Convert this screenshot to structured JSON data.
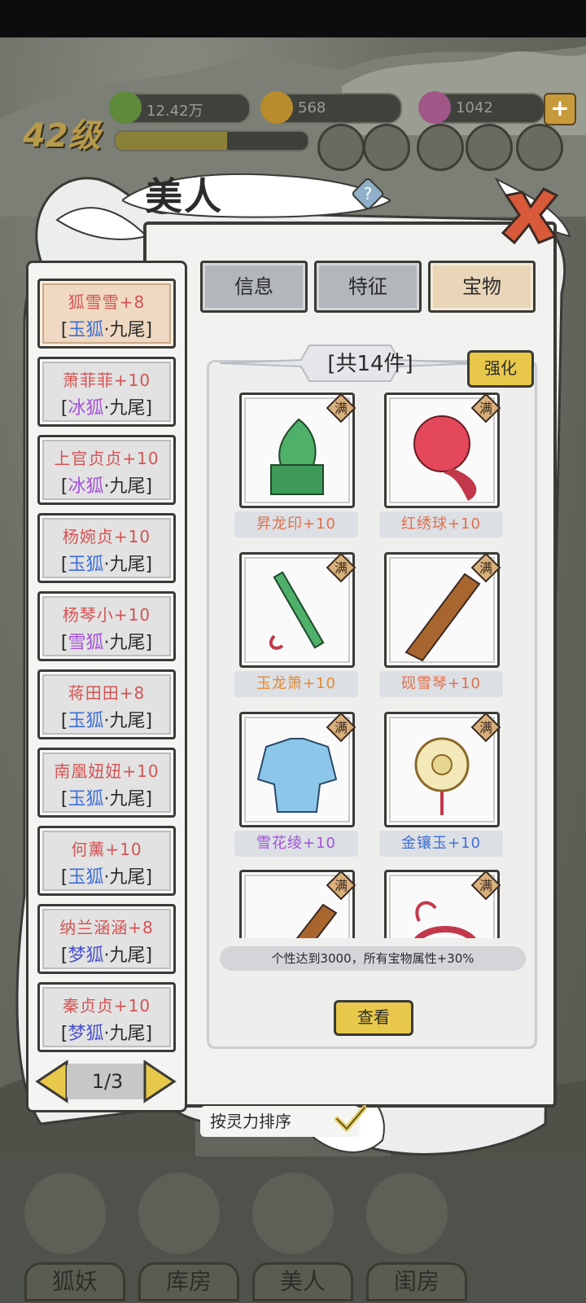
{
  "resources": {
    "spirit": "12.42万",
    "gold": "568",
    "gems": "1042"
  },
  "level": "42级",
  "exp_progress": 0.58,
  "title": "美人",
  "tabs": [
    {
      "label": "信息",
      "active": false
    },
    {
      "label": "特征",
      "active": false
    },
    {
      "label": "宝物",
      "active": true
    }
  ],
  "beauties": [
    {
      "name": "狐雪雪+8",
      "br_l": "[",
      "fox": "玉狐",
      "fox_color": "#3e6fd6",
      "rest": "·九尾",
      "br_r": "]",
      "selected": true
    },
    {
      "name": "萧菲菲+10",
      "br_l": "[",
      "fox": "冰狐",
      "fox_color": "#a352d8",
      "rest": "·九尾",
      "br_r": "]",
      "selected": false
    },
    {
      "name": "上官贞贞+10",
      "br_l": "[",
      "fox": "冰狐",
      "fox_color": "#a352d8",
      "rest": "·九尾",
      "br_r": "]",
      "selected": false
    },
    {
      "name": "杨婉贞+10",
      "br_l": "[",
      "fox": "玉狐",
      "fox_color": "#3e6fd6",
      "rest": "·九尾",
      "br_r": "]",
      "selected": false
    },
    {
      "name": "杨琴小+10",
      "br_l": "[",
      "fox": "雪狐",
      "fox_color": "#a352d8",
      "rest": "·九尾",
      "br_r": "]",
      "selected": false
    },
    {
      "name": "蒋田田+8",
      "br_l": "[",
      "fox": "玉狐",
      "fox_color": "#3e6fd6",
      "rest": "·九尾",
      "br_r": "]",
      "selected": false
    },
    {
      "name": "南凰妞妞+10",
      "br_l": "[",
      "fox": "玉狐",
      "fox_color": "#3e6fd6",
      "rest": "·九尾",
      "br_r": "]",
      "selected": false
    },
    {
      "name": "何薰+10",
      "br_l": "[",
      "fox": "玉狐",
      "fox_color": "#3e6fd6",
      "rest": "·九尾",
      "br_r": "]",
      "selected": false
    },
    {
      "name": "纳兰涵涵+8",
      "br_l": "[",
      "fox": "梦狐",
      "fox_color": "#4a52cc",
      "rest": "·九尾",
      "br_r": "]",
      "selected": false
    },
    {
      "name": "秦贞贞+10",
      "br_l": "[",
      "fox": "梦狐",
      "fox_color": "#4a52cc",
      "rest": "·九尾",
      "br_r": "]",
      "selected": false
    }
  ],
  "pager": {
    "text": "1/3"
  },
  "treasure": {
    "count": "[共14件]",
    "upgrade_label": "强化",
    "max_tag": "满",
    "items": [
      {
        "name": "昇龙印+10",
        "color": "#e0704a",
        "icon": "dragon-seal"
      },
      {
        "name": "红绣球+10",
        "color": "#e0704a",
        "icon": "red-silk-ball"
      },
      {
        "name": "玉龙箫+10",
        "color": "#e58a2e",
        "icon": "jade-flute"
      },
      {
        "name": "砚雪琴+10",
        "color": "#e0704a",
        "icon": "guqin"
      },
      {
        "name": "雪花绫+10",
        "color": "#a352d8",
        "icon": "robe"
      },
      {
        "name": "金镶玉+10",
        "color": "#3e6fd6",
        "icon": "jade-pendant"
      }
    ],
    "bonus_text": "个性达到3000，所有宝物属性+30%",
    "view_label": "查看"
  },
  "sort_label": "按灵力排序",
  "bottom_nav": [
    "狐妖",
    "库房",
    "美人",
    "闺房"
  ],
  "colors": {
    "accent": "#e8c84a",
    "name_red": "#d35454"
  }
}
